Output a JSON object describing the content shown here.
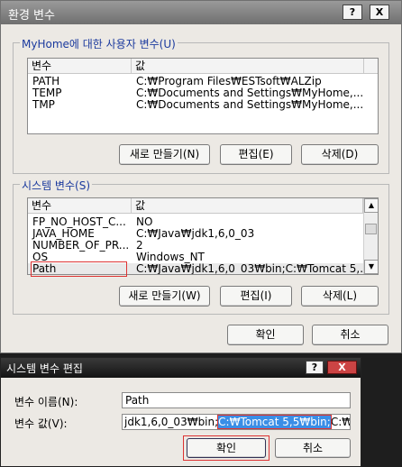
{
  "main_dialog": {
    "title": "환경 변수",
    "help_label": "?",
    "close_label": "X",
    "user_vars": {
      "group_label": "MyHome에 대한 사용자 변수(U)",
      "columns": [
        "변수",
        "값"
      ],
      "rows": [
        {
          "name": "PATH",
          "value": "C:₩Program Files₩ESTsoft₩ALZip"
        },
        {
          "name": "TEMP",
          "value": "C:₩Documents and Settings₩MyHome,..."
        },
        {
          "name": "TMP",
          "value": "C:₩Documents and Settings₩MyHome,..."
        }
      ],
      "new_label": "새로 만들기(N)",
      "edit_label": "편집(E)",
      "delete_label": "삭제(D)"
    },
    "system_vars": {
      "group_label": "시스템 변수(S)",
      "columns": [
        "변수",
        "값"
      ],
      "rows": [
        {
          "name": "FP_NO_HOST_C...",
          "value": "NO"
        },
        {
          "name": "JAVA_HOME",
          "value": "C:₩Java₩jdk1,6,0_03"
        },
        {
          "name": "NUMBER_OF_PR...",
          "value": "2"
        },
        {
          "name": "OS",
          "value": "Windows_NT"
        },
        {
          "name": "Path",
          "value": "C:₩Java₩jdk1,6,0_03₩bin;C:₩Tomcat 5,..."
        }
      ],
      "scroll_up": "▲",
      "scroll_down": "▼",
      "new_label": "새로 만들기(W)",
      "edit_label": "편집(I)",
      "delete_label": "삭제(L)"
    },
    "ok_label": "확인",
    "cancel_label": "취소"
  },
  "edit_dialog": {
    "title": "시스템 변수 편집",
    "help_label": "?",
    "close_label": "X",
    "name_label": "변수 이름(N):",
    "name_value": "Path",
    "value_label": "변수 값(V):",
    "value_before": "jdk1,6,0_03₩bin;",
    "value_selected": "C:₩Tomcat 5,5₩bin;",
    "value_after": "C:₩ora",
    "ok_label": "확인",
    "cancel_label": "취소"
  },
  "colors": {
    "selection": "#3a8ee6",
    "highlight_box": "#dd3333",
    "group_label_text": "#1b3a9e"
  }
}
